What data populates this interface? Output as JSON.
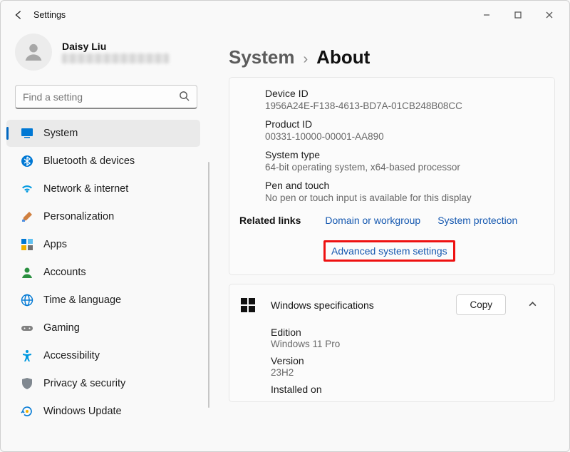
{
  "window": {
    "title": "Settings"
  },
  "profile": {
    "name": "Daisy Liu"
  },
  "search": {
    "placeholder": "Find a setting"
  },
  "sidebar": {
    "items": [
      {
        "label": "System",
        "icon": "system"
      },
      {
        "label": "Bluetooth & devices",
        "icon": "bluetooth"
      },
      {
        "label": "Network & internet",
        "icon": "wifi"
      },
      {
        "label": "Personalization",
        "icon": "brush"
      },
      {
        "label": "Apps",
        "icon": "apps"
      },
      {
        "label": "Accounts",
        "icon": "account"
      },
      {
        "label": "Time & language",
        "icon": "globe"
      },
      {
        "label": "Gaming",
        "icon": "gamepad"
      },
      {
        "label": "Accessibility",
        "icon": "accessibility"
      },
      {
        "label": "Privacy & security",
        "icon": "shield"
      },
      {
        "label": "Windows Update",
        "icon": "update"
      }
    ]
  },
  "breadcrumb": {
    "parent": "System",
    "current": "About"
  },
  "device": {
    "deviceId": {
      "label": "Device ID",
      "value": "1956A24E-F138-4613-BD7A-01CB248B08CC"
    },
    "productId": {
      "label": "Product ID",
      "value": "00331-10000-00001-AA890"
    },
    "systemType": {
      "label": "System type",
      "value": "64-bit operating system, x64-based processor"
    },
    "penTouch": {
      "label": "Pen and touch",
      "value": "No pen or touch input is available for this display"
    }
  },
  "related": {
    "title": "Related links",
    "links": {
      "domain": "Domain or workgroup",
      "sysprot": "System protection",
      "advanced": "Advanced system settings"
    }
  },
  "winspecs": {
    "title": "Windows specifications",
    "copy": "Copy",
    "edition": {
      "label": "Edition",
      "value": "Windows 11 Pro"
    },
    "version": {
      "label": "Version",
      "value": "23H2"
    },
    "installed": {
      "label": "Installed on"
    }
  }
}
